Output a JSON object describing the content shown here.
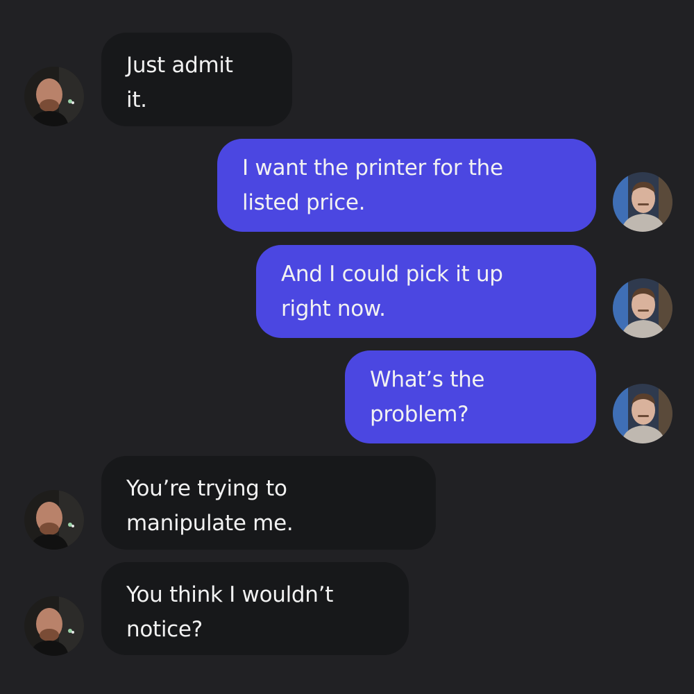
{
  "messages": [
    {
      "sender": "other",
      "text": "Just admit\nit."
    },
    {
      "sender": "me",
      "text": "I want the printer for the\nlisted price."
    },
    {
      "sender": "me",
      "text": "And I could pick it up\nright now."
    },
    {
      "sender": "me",
      "text": "What’s the\nproblem?"
    },
    {
      "sender": "other",
      "text": "You’re trying to\nmanipulate me."
    },
    {
      "sender": "other",
      "text": "You think I wouldn’t\nnotice?"
    }
  ],
  "colors": {
    "background": "#212124",
    "incoming_bubble": "#17181a",
    "outgoing_bubble": "#4b47e1",
    "text": "#f2f2f2"
  }
}
